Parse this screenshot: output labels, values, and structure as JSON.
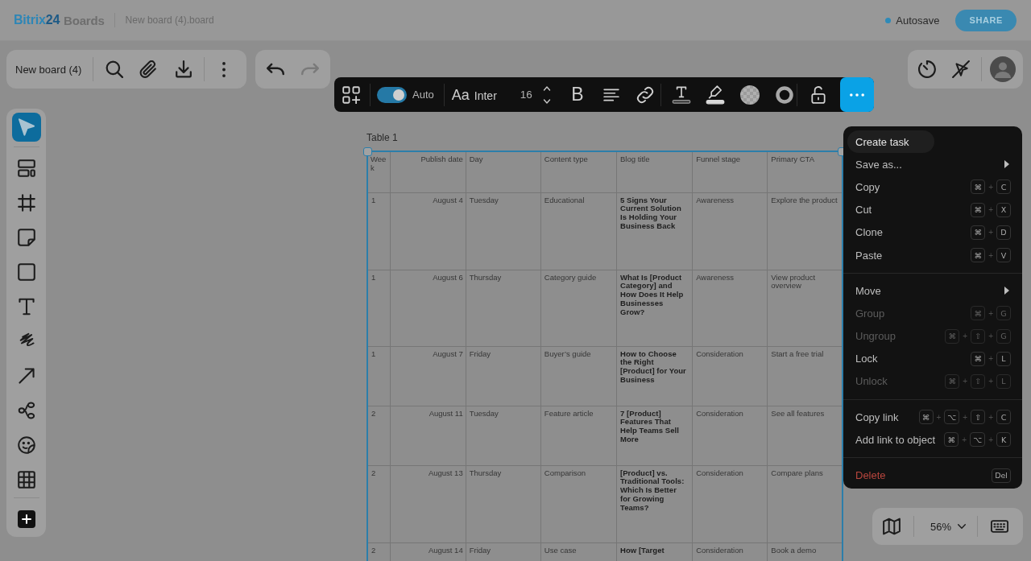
{
  "header": {
    "logo_word": "Bitrix",
    "logo_number": "24",
    "product": "Boards",
    "file_name": "New board (4).board",
    "autosave": "Autosave",
    "share": "SHARE"
  },
  "board_bar": {
    "title": "New board (4)"
  },
  "history": {
    "undo_disabled": false,
    "redo_disabled": true
  },
  "format_toolbar": {
    "auto_toggle": {
      "label": "Auto",
      "on": true
    },
    "font_glyph": "Aa",
    "font": "Inter",
    "font_size": "16",
    "bold_glyph": "B",
    "more_selected": true
  },
  "tools": [
    {
      "kind": "select",
      "selected": true
    },
    {
      "kind": "templates",
      "selected": false
    },
    {
      "kind": "frame",
      "selected": false
    },
    {
      "kind": "sticky",
      "selected": false
    },
    {
      "kind": "shape",
      "selected": false
    },
    {
      "kind": "text",
      "selected": false
    },
    {
      "kind": "pen",
      "selected": false
    },
    {
      "kind": "arrow",
      "selected": false
    },
    {
      "kind": "mindmap",
      "selected": false
    },
    {
      "kind": "sticker",
      "selected": false
    },
    {
      "kind": "table",
      "selected": false
    },
    {
      "kind": "add",
      "selected": false
    }
  ],
  "table": {
    "title": "Table 1",
    "columns": [
      "Week",
      "Publish date",
      "Day",
      "Content type",
      "Blog title",
      "Funnel stage",
      "Primary CTA"
    ],
    "rows": [
      [
        "1",
        "August 4",
        "Tuesday",
        "Educational",
        "5 Signs Your Current Solution Is Holding Your Business Back",
        "Awareness",
        "Explore the product"
      ],
      [
        "1",
        "August 6",
        "Thursday",
        "Category guide",
        "What Is [Product Category] and How Does It Help Businesses Grow?",
        "Awareness",
        "View product overview"
      ],
      [
        "1",
        "August 7",
        "Friday",
        "Buyer’s guide",
        "How to Choose the Right [Product] for Your Business",
        "Consideration",
        "Start a free trial"
      ],
      [
        "2",
        "August 11",
        "Tuesday",
        "Feature article",
        "7 [Product] Features That Help Teams Sell More",
        "Consideration",
        "See all features"
      ],
      [
        "2",
        "August 13",
        "Thursday",
        "Comparison",
        "[Product] vs. Traditional Tools: Which Is Better for Growing Teams?",
        "Consideration",
        "Compare plans"
      ],
      [
        "2",
        "August 14",
        "Friday",
        "Use case",
        "How [Target",
        "Consideration",
        "Book a demo"
      ]
    ]
  },
  "context_menu": {
    "groups": [
      [
        {
          "label": "Create task",
          "kind": "action",
          "highlighted": true,
          "disabled": false,
          "submenu": false
        },
        {
          "label": "Save as...",
          "kind": "action",
          "highlighted": false,
          "disabled": false,
          "submenu": true
        },
        {
          "label": "Copy",
          "kind": "action",
          "highlighted": false,
          "disabled": false,
          "submenu": false,
          "shortcut": [
            "⌘",
            "+",
            "C"
          ]
        },
        {
          "label": "Cut",
          "kind": "action",
          "highlighted": false,
          "disabled": false,
          "submenu": false,
          "shortcut": [
            "⌘",
            "+",
            "X"
          ]
        },
        {
          "label": "Clone",
          "kind": "action",
          "highlighted": false,
          "disabled": false,
          "submenu": false,
          "shortcut": [
            "⌘",
            "+",
            "D"
          ]
        },
        {
          "label": "Paste",
          "kind": "action",
          "highlighted": false,
          "disabled": false,
          "submenu": false,
          "shortcut": [
            "⌘",
            "+",
            "V"
          ]
        }
      ],
      [
        {
          "label": "Move",
          "kind": "action",
          "highlighted": false,
          "disabled": false,
          "submenu": true
        },
        {
          "label": "Group",
          "kind": "action",
          "highlighted": false,
          "disabled": true,
          "submenu": false,
          "shortcut": [
            "⌘",
            "+",
            "G"
          ]
        },
        {
          "label": "Ungroup",
          "kind": "action",
          "highlighted": false,
          "disabled": true,
          "submenu": false,
          "shortcut": [
            "⌘",
            "+",
            "⇧",
            "+",
            "G"
          ]
        },
        {
          "label": "Lock",
          "kind": "action",
          "highlighted": false,
          "disabled": false,
          "submenu": false,
          "shortcut": [
            "⌘",
            "+",
            "L"
          ]
        },
        {
          "label": "Unlock",
          "kind": "action",
          "highlighted": false,
          "disabled": true,
          "submenu": false,
          "shortcut": [
            "⌘",
            "+",
            "⇧",
            "+",
            "L"
          ]
        }
      ],
      [
        {
          "label": "Copy link",
          "kind": "action",
          "highlighted": false,
          "disabled": false,
          "submenu": false,
          "shortcut": [
            "⌘",
            "+",
            "⌥",
            "+",
            "⇧",
            "+",
            "C"
          ]
        },
        {
          "label": "Add link to object",
          "kind": "action",
          "highlighted": false,
          "disabled": false,
          "submenu": false,
          "shortcut": [
            "⌘",
            "+",
            "⌥",
            "+",
            "K"
          ]
        }
      ],
      [
        {
          "label": "Delete",
          "kind": "danger",
          "highlighted": false,
          "disabled": false,
          "submenu": false,
          "shortcut": [
            "Del"
          ]
        }
      ]
    ]
  },
  "zoom": {
    "value": "56%"
  }
}
